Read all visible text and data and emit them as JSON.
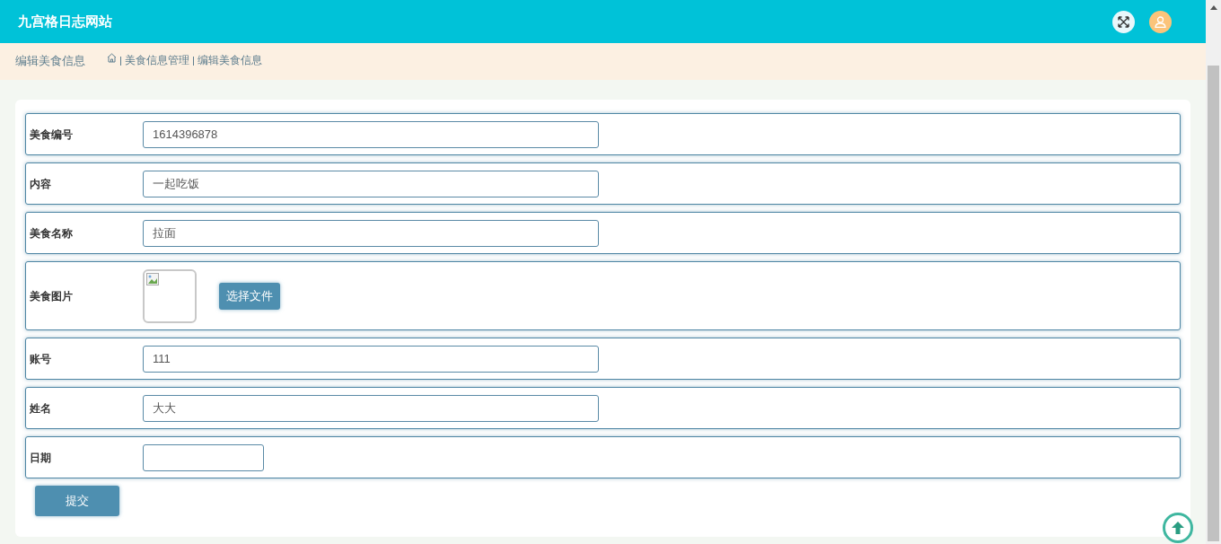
{
  "header": {
    "title": "九宫格日志网站"
  },
  "breadcrumb": {
    "page_title": "编辑美食信息",
    "trail": [
      "美食信息管理",
      "编辑美食信息"
    ]
  },
  "form": {
    "rows": [
      {
        "kind": "text",
        "label": "美食编号",
        "value": "1614396878"
      },
      {
        "kind": "text",
        "label": "内容",
        "value": "一起吃饭"
      },
      {
        "kind": "text",
        "label": "美食名称",
        "value": "拉面"
      },
      {
        "kind": "image",
        "label": "美食图片",
        "button": "选择文件"
      },
      {
        "kind": "text",
        "label": "账号",
        "value": "111"
      },
      {
        "kind": "text",
        "label": "姓名",
        "value": "大大"
      },
      {
        "kind": "date",
        "label": "日期",
        "value": ""
      }
    ],
    "submit": "提交"
  }
}
